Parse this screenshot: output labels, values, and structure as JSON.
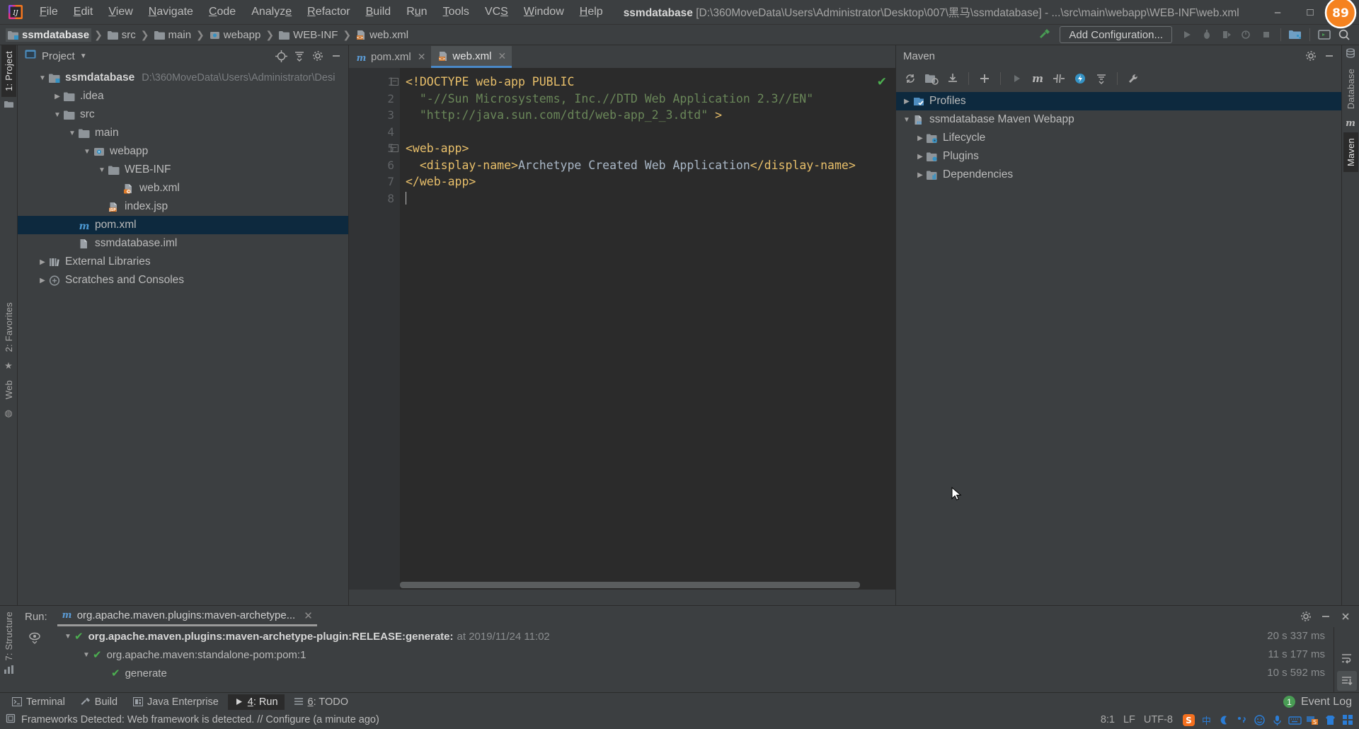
{
  "window": {
    "title_project": "ssmdatabase",
    "title_path": "[D:\\360MoveData\\Users\\Administrator\\Desktop\\007\\黑马\\ssmdatabase] - ...\\src\\main\\webapp\\WEB-INF\\web.xml",
    "minimize": "–",
    "maximize": "□",
    "close": "✕"
  },
  "menu": [
    {
      "label": "File"
    },
    {
      "label": "Edit"
    },
    {
      "label": "View"
    },
    {
      "label": "Navigate"
    },
    {
      "label": "Code"
    },
    {
      "label": "Analyze"
    },
    {
      "label": "Refactor"
    },
    {
      "label": "Build"
    },
    {
      "label": "Run"
    },
    {
      "label": "Tools"
    },
    {
      "label": "VCS"
    },
    {
      "label": "Window"
    },
    {
      "label": "Help"
    }
  ],
  "breadcrumb": [
    {
      "label": "ssmdatabase",
      "icon": "module-folder-icon"
    },
    {
      "label": "src",
      "icon": "folder-icon"
    },
    {
      "label": "main",
      "icon": "folder-icon"
    },
    {
      "label": "webapp",
      "icon": "web-folder-icon"
    },
    {
      "label": "WEB-INF",
      "icon": "folder-icon"
    },
    {
      "label": "web.xml",
      "icon": "xml-file-icon"
    }
  ],
  "toolbar": {
    "add_configuration": "Add Configuration...",
    "icons": [
      "build-hammer-icon",
      "run-icon",
      "debug-icon",
      "run-coverage-icon",
      "profile-icon",
      "stop-icon",
      "project-structure-icon",
      "open-console-icon",
      "search-everywhere-icon"
    ]
  },
  "project_panel": {
    "title": "Project",
    "header_icons": [
      "locate-icon",
      "collapse-all-icon",
      "settings-gear-icon",
      "hide-icon"
    ],
    "tree": [
      {
        "depth": 0,
        "arrow": "down",
        "icon": "module-folder-icon",
        "label": "ssmdatabase",
        "bold": true,
        "path": "D:\\360MoveData\\Users\\Administrator\\Desi"
      },
      {
        "depth": 1,
        "arrow": "right",
        "icon": "folder-icon",
        "label": ".idea",
        "bold": false,
        "path": ""
      },
      {
        "depth": 1,
        "arrow": "down",
        "icon": "folder-icon",
        "label": "src",
        "bold": false,
        "path": ""
      },
      {
        "depth": 2,
        "arrow": "down",
        "icon": "folder-icon",
        "label": "main",
        "bold": false,
        "path": ""
      },
      {
        "depth": 3,
        "arrow": "down",
        "icon": "web-folder-icon",
        "label": "webapp",
        "bold": false,
        "path": ""
      },
      {
        "depth": 4,
        "arrow": "down",
        "icon": "folder-icon",
        "label": "WEB-INF",
        "bold": false,
        "path": ""
      },
      {
        "depth": 5,
        "arrow": "none",
        "icon": "xml-file-icon",
        "label": "web.xml",
        "bold": false,
        "path": ""
      },
      {
        "depth": 4,
        "arrow": "none",
        "icon": "jsp-file-icon",
        "label": "index.jsp",
        "bold": false,
        "path": ""
      },
      {
        "depth": 2,
        "arrow": "none",
        "icon": "maven-pom-icon",
        "label": "pom.xml",
        "bold": false,
        "path": "",
        "selected": true
      },
      {
        "depth": 2,
        "arrow": "none",
        "icon": "iml-file-icon",
        "label": "ssmdatabase.iml",
        "bold": false,
        "path": ""
      },
      {
        "depth": 0,
        "arrow": "right",
        "icon": "libraries-icon",
        "label": "External Libraries",
        "bold": false,
        "path": ""
      },
      {
        "depth": 0,
        "arrow": "right",
        "icon": "scratches-icon",
        "label": "Scratches and Consoles",
        "bold": false,
        "path": ""
      }
    ]
  },
  "editor": {
    "tabs": [
      {
        "label": "pom.xml",
        "icon": "maven-pom-icon",
        "active": false,
        "close": "✕"
      },
      {
        "label": "web.xml",
        "icon": "xml-file-icon",
        "active": true,
        "close": "✕"
      }
    ],
    "line_numbers": [
      "1",
      "2",
      "3",
      "4",
      "5",
      "6",
      "7",
      "8"
    ],
    "lines": [
      {
        "n": 1,
        "segments": [
          {
            "t": "<!DOCTYPE web-app PUBLIC",
            "c": "k-dt"
          }
        ]
      },
      {
        "n": 2,
        "segments": [
          {
            "t": "  \"-//Sun Microsystems, Inc.//DTD Web Application 2.3//EN\"",
            "c": "k-str"
          }
        ]
      },
      {
        "n": 3,
        "segments": [
          {
            "t": "  \"http://java.sun.com/dtd/web-app_2_3.dtd\" ",
            "c": "k-str"
          },
          {
            "t": ">",
            "c": "k-dt"
          }
        ]
      },
      {
        "n": 4,
        "segments": [
          {
            "t": "",
            "c": "k-txt"
          }
        ]
      },
      {
        "n": 5,
        "segments": [
          {
            "t": "<web-app>",
            "c": "k-tag"
          }
        ]
      },
      {
        "n": 6,
        "segments": [
          {
            "t": "  <display-name>",
            "c": "k-tag"
          },
          {
            "t": "Archetype Created Web Application",
            "c": "k-txt"
          },
          {
            "t": "</display-name>",
            "c": "k-tag"
          }
        ]
      },
      {
        "n": 7,
        "segments": [
          {
            "t": "</web-app>",
            "c": "k-tag"
          }
        ]
      },
      {
        "n": 8,
        "segments": [
          {
            "t": "",
            "c": "k-txt"
          }
        ]
      }
    ],
    "inspection_status": "✔"
  },
  "maven_panel": {
    "title": "Maven",
    "header_icons": [
      "settings-gear-icon",
      "hide-icon"
    ],
    "toolbar_icons": [
      "reimport-icon",
      "generate-sources-icon",
      "download-sources-icon",
      "add-maven-project-icon",
      "run-icon",
      "execute-maven-goal-icon",
      "toggle-skip-tests-icon",
      "toggle-offline-icon",
      "collapse-all-icon",
      "maven-settings-icon"
    ],
    "tree": [
      {
        "depth": 0,
        "arrow": "right",
        "icon": "profiles-icon",
        "label": "Profiles",
        "selected": true
      },
      {
        "depth": 0,
        "arrow": "down",
        "icon": "maven-project-icon",
        "label": "ssmdatabase Maven Webapp",
        "selected": false
      },
      {
        "depth": 1,
        "arrow": "right",
        "icon": "lifecycle-icon",
        "label": "Lifecycle",
        "selected": false
      },
      {
        "depth": 1,
        "arrow": "right",
        "icon": "plugins-icon",
        "label": "Plugins",
        "selected": false
      },
      {
        "depth": 1,
        "arrow": "right",
        "icon": "dependencies-icon",
        "label": "Dependencies",
        "selected": false
      }
    ]
  },
  "run_panel": {
    "label": "Run:",
    "tab_label": "org.apache.maven.plugins:maven-archetype...",
    "tab_close": "✕",
    "header_icons": [
      "settings-gear-icon",
      "minimize-icon",
      "close-icon"
    ],
    "rows": [
      {
        "depth": 0,
        "arrow": "down",
        "status": "✔",
        "label": "org.apache.maven.plugins:maven-archetype-plugin:RELEASE:generate:",
        "bold": true,
        "suffix": "at 2019/11/24 11:02",
        "time": "20 s 337 ms"
      },
      {
        "depth": 1,
        "arrow": "down",
        "status": "✔",
        "label": "org.apache.maven:standalone-pom:pom:1",
        "bold": false,
        "suffix": "",
        "time": "11 s 177 ms"
      },
      {
        "depth": 2,
        "arrow": "none",
        "status": "✔",
        "label": "generate",
        "bold": false,
        "suffix": "",
        "time": "10 s 592 ms"
      }
    ],
    "side_icons": [
      "wrap-text-icon",
      "scroll-to-end-icon"
    ]
  },
  "left_strip": {
    "tabs": [
      {
        "label": "1: Project",
        "active": true
      },
      {
        "label": "2: Favorites",
        "active": false
      },
      {
        "label": "Web",
        "active": false
      },
      {
        "label": "7: Structure",
        "active": false
      }
    ]
  },
  "right_strip": {
    "tabs": [
      {
        "label": "Database",
        "active": false
      },
      {
        "label": "Maven",
        "active": true
      }
    ]
  },
  "bottom_tabs": [
    {
      "label": "Terminal",
      "icon": "terminal-icon",
      "active": false,
      "mnemonic": ""
    },
    {
      "label": "Build",
      "icon": "build-hammer-icon",
      "active": false,
      "mnemonic": ""
    },
    {
      "label": "Java Enterprise",
      "icon": "java-enterprise-icon",
      "active": false,
      "mnemonic": ""
    },
    {
      "label": "4: Run",
      "icon": "run-icon",
      "active": true,
      "mnemonic": "4"
    },
    {
      "label": "6: TODO",
      "icon": "todo-icon",
      "active": false,
      "mnemonic": "6"
    }
  ],
  "event_log": {
    "label": "Event Log",
    "count": "1"
  },
  "status_bar": {
    "message": "Frameworks Detected: Web framework is detected. // Configure (a minute ago)",
    "caret_position": "8:1",
    "line_separator": "LF",
    "encoding": "UTF-8",
    "icon": "inspection-hint-icon"
  },
  "colors": {
    "panel_bg": "#3c3f41",
    "editor_bg": "#2b2b2b",
    "selection_blue": "#0d293e",
    "accent_blue": "#4a88c7",
    "success_green": "#4caf50",
    "orange": "#cc7832",
    "string_green": "#6a8759",
    "doctype_yellow": "#e8bf6a"
  }
}
